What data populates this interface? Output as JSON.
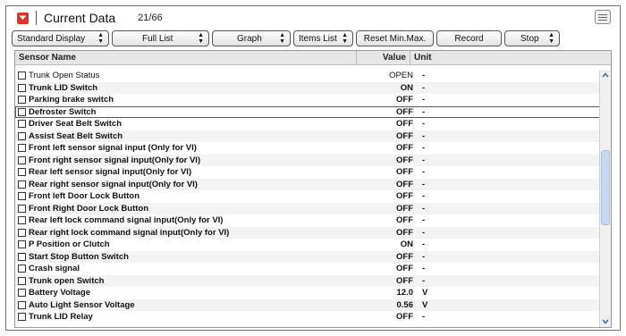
{
  "header": {
    "title": "Current Data",
    "counter": "21/66"
  },
  "toolbar": {
    "display_mode": "Standard Display",
    "list_mode": "Full List",
    "graph": "Graph",
    "items_list": "Items List",
    "reset_minmax": "Reset Min.Max.",
    "record": "Record",
    "stop": "Stop"
  },
  "table": {
    "columns": {
      "name": "Sensor Name",
      "value": "Value",
      "unit": "Unit"
    },
    "rows": [
      {
        "name": "Trunk Open Status",
        "value": "OPEN",
        "unit": "-"
      },
      {
        "name": "Trunk LID Switch",
        "value": "ON",
        "unit": "-"
      },
      {
        "name": "Parking brake switch",
        "value": "OFF",
        "unit": "-"
      },
      {
        "name": "Defroster Switch",
        "value": "OFF",
        "unit": "-"
      },
      {
        "name": "Driver Seat Belt Switch",
        "value": "OFF",
        "unit": "-"
      },
      {
        "name": "Assist Seat Belt Switch",
        "value": "OFF",
        "unit": "-"
      },
      {
        "name": "Front left sensor signal input (Only for VI)",
        "value": "OFF",
        "unit": "-"
      },
      {
        "name": "Front right sensor signal input(Only for VI)",
        "value": "OFF",
        "unit": "-"
      },
      {
        "name": "Rear  left sensor signal input(Only for VI)",
        "value": "OFF",
        "unit": "-"
      },
      {
        "name": "Rear right sensor signal input(Only for VI)",
        "value": "OFF",
        "unit": "-"
      },
      {
        "name": "Front left Door Lock Button",
        "value": "OFF",
        "unit": "-"
      },
      {
        "name": "Front Right Door Lock Button",
        "value": "OFF",
        "unit": "-"
      },
      {
        "name": "Rear left lock command signal input(Only for VI)",
        "value": "OFF",
        "unit": "-"
      },
      {
        "name": "Rear right lock command signal input(Only for VI)",
        "value": "OFF",
        "unit": "-"
      },
      {
        "name": "P Position or Clutch",
        "value": "ON",
        "unit": "-"
      },
      {
        "name": "Start Stop Button Switch",
        "value": "OFF",
        "unit": "-"
      },
      {
        "name": "Crash signal",
        "value": "OFF",
        "unit": "-"
      },
      {
        "name": "Trunk open Switch",
        "value": "OFF",
        "unit": "-"
      },
      {
        "name": "Battery Voltage",
        "value": "12.0",
        "unit": "V"
      },
      {
        "name": "Auto Light Sensor Voltage",
        "value": "0.56",
        "unit": "V"
      },
      {
        "name": "Trunk LID Relay",
        "value": "OFF",
        "unit": "-"
      }
    ]
  },
  "colors": {
    "selection_outline": "#d6202a",
    "collapse_button": "#d9342b",
    "scroll_thumb": "#c9d9ee"
  },
  "icons": {
    "collapse": "chevron-down-icon",
    "panel": "panel-layout-icon",
    "scroll_up": "chevron-up-icon",
    "scroll_down": "chevron-down-icon"
  }
}
